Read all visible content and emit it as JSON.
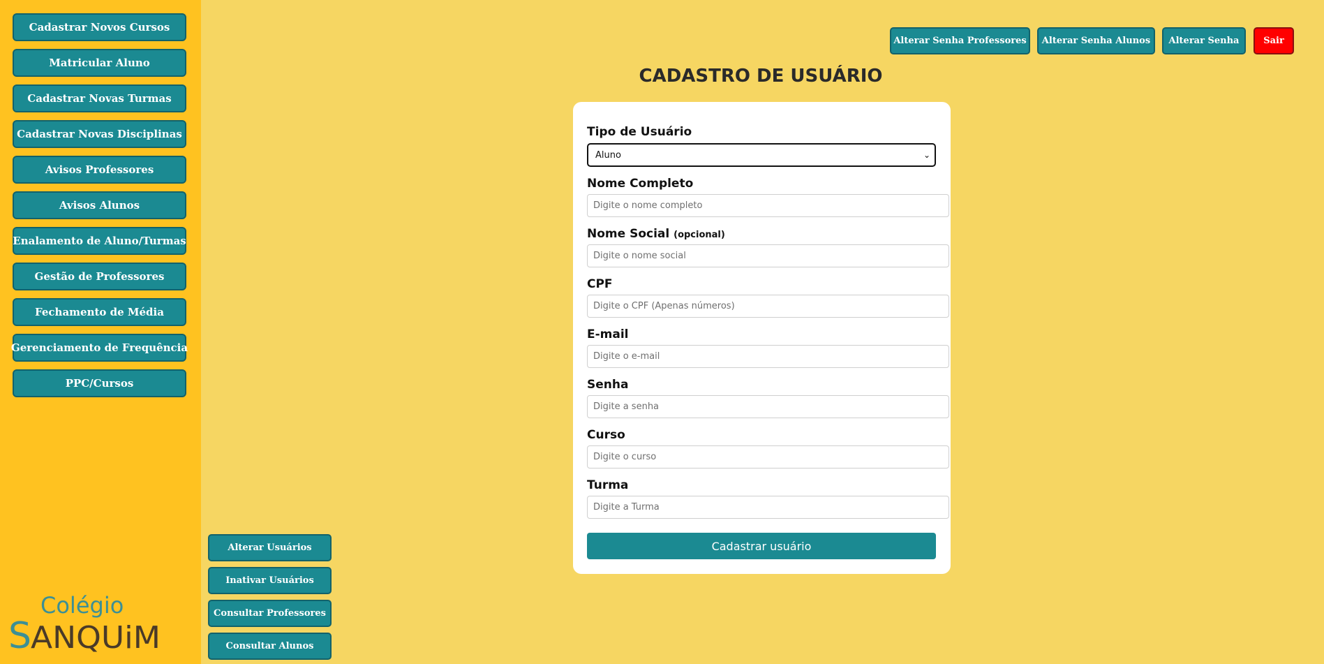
{
  "sidebar": {
    "items": [
      {
        "label": "Cadastrar Novos Cursos"
      },
      {
        "label": "Matricular Aluno"
      },
      {
        "label": "Cadastrar Novas Turmas"
      },
      {
        "label": "Cadastrar Novas Disciplinas"
      },
      {
        "label": "Avisos Professores"
      },
      {
        "label": "Avisos Alunos"
      },
      {
        "label": "Enalamento de Aluno/Turmas"
      },
      {
        "label": "Gestão de Professores"
      },
      {
        "label": "Fechamento de Média"
      },
      {
        "label": "Gerenciamento de Frequência"
      },
      {
        "label": "PPC/Cursos"
      }
    ]
  },
  "logo": {
    "top_text": "Colégio",
    "bottom_text": "ANQUiM",
    "letter": "S",
    "teal_color": "#3c8f95",
    "brown_color": "#4a3a28"
  },
  "bottom_actions": [
    {
      "label": "Alterar Usuários"
    },
    {
      "label": "Inativar Usuários"
    },
    {
      "label": "Consultar Professores"
    },
    {
      "label": "Consultar Alunos"
    }
  ],
  "header": {
    "actions": [
      {
        "label": "Alterar Senha Professores"
      },
      {
        "label": "Alterar Senha Alunos"
      },
      {
        "label": "Alterar Senha"
      },
      {
        "label": "Sair"
      }
    ]
  },
  "page": {
    "title": "CADASTRO DE USUÁRIO"
  },
  "form": {
    "user_type": {
      "label": "Tipo de Usuário",
      "value": "Aluno"
    },
    "full_name": {
      "label": "Nome Completo",
      "placeholder": "Digite o nome completo"
    },
    "social_name": {
      "label": "Nome Social",
      "optional": "(opcional)",
      "placeholder": "Digite o nome social"
    },
    "cpf": {
      "label": "CPF",
      "placeholder": "Digite o CPF (Apenas números)"
    },
    "email": {
      "label": "E-mail",
      "placeholder": "Digite o e-mail"
    },
    "password": {
      "label": "Senha",
      "placeholder": "Digite a senha"
    },
    "course": {
      "label": "Curso",
      "placeholder": "Digite o curso"
    },
    "class": {
      "label": "Turma",
      "placeholder": "Digite a Turma"
    },
    "submit_label": "Cadastrar usuário"
  },
  "colors": {
    "background": "#f6d662",
    "sidebar": "#ffc220",
    "button": "#1b8a92",
    "exit_button": "#ff0000"
  }
}
